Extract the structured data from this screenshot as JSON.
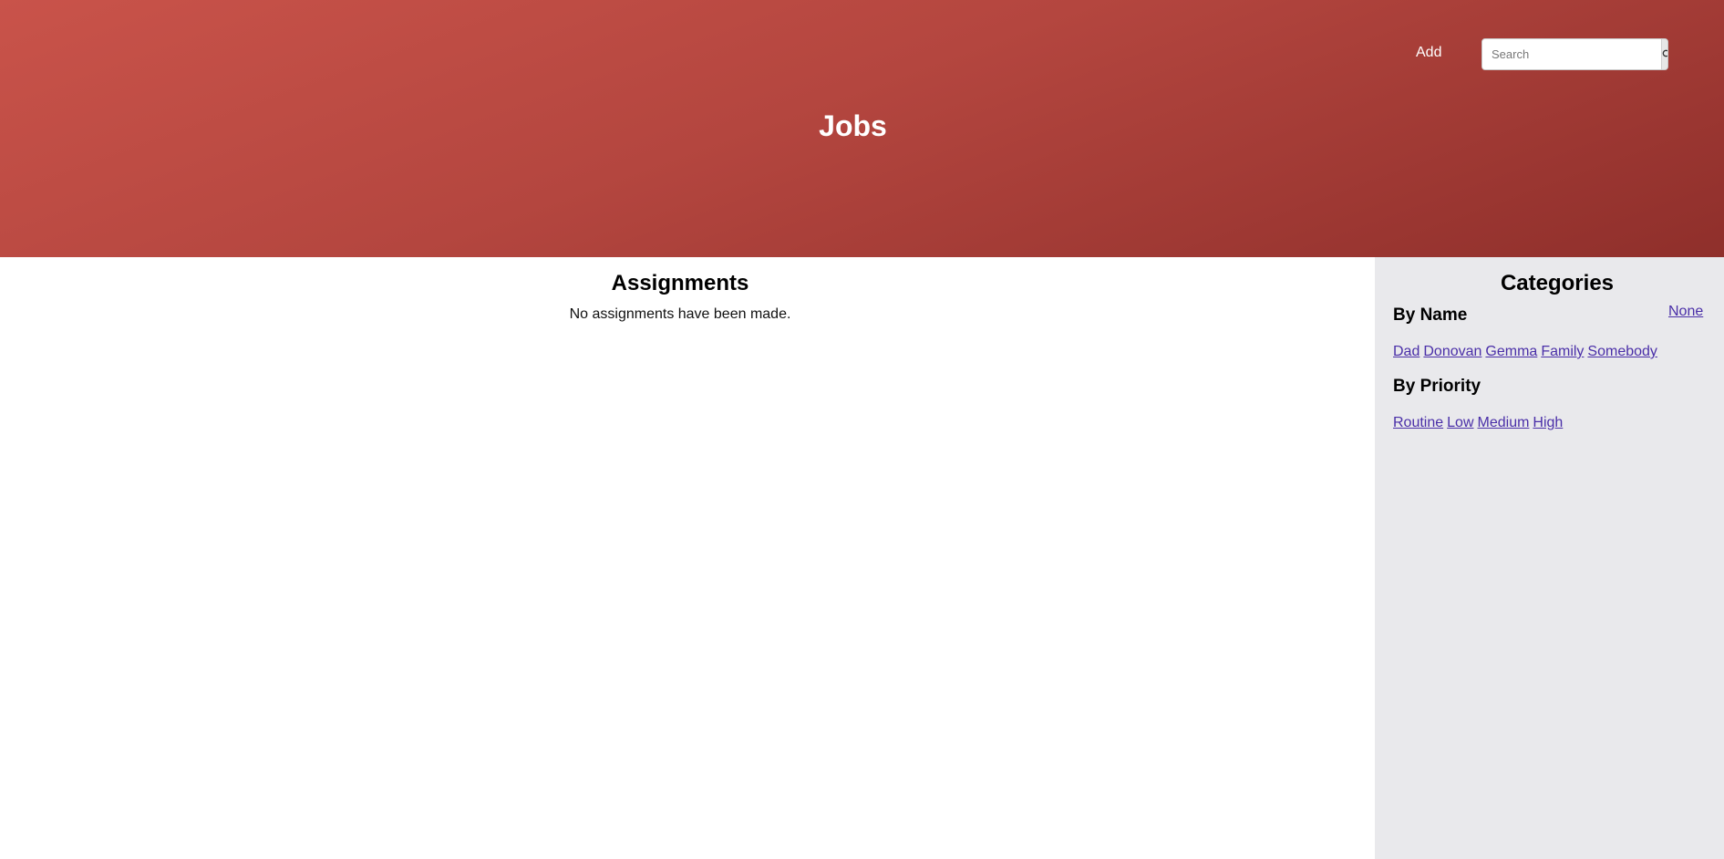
{
  "header": {
    "add_label": "Add",
    "search_placeholder": "Search",
    "title": "Jobs",
    "gradient_colors": [
      "#c9534a",
      "#8f2f2b"
    ]
  },
  "main": {
    "heading": "Assignments",
    "empty_message": "No assignments have been made."
  },
  "sidebar": {
    "heading": "Categories",
    "none_label": "None",
    "by_name": {
      "title": "By Name",
      "links": [
        "Dad",
        "Donovan",
        "Gemma",
        "Family",
        "Somebody"
      ]
    },
    "by_priority": {
      "title": "By Priority",
      "links": [
        "Routine",
        "Low",
        "Medium",
        "High"
      ]
    },
    "background_color": "#e9e9ec",
    "link_color": "#4a2fa8"
  },
  "icons": {
    "search_button": "search-icon"
  }
}
